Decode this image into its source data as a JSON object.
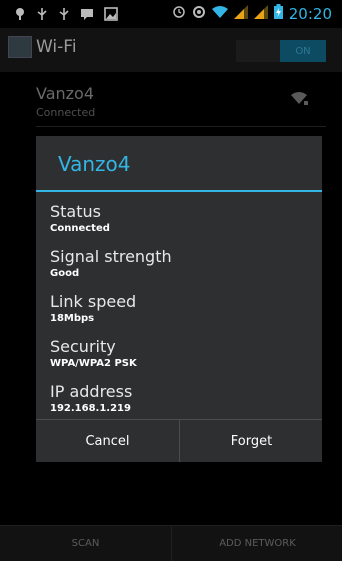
{
  "status_bar": {
    "time": "20:20",
    "left_icons": [
      "usb-icon",
      "usb-icon",
      "usb-icon",
      "message-icon",
      "image-icon"
    ],
    "right_icons": [
      "alarm-icon",
      "sync-icon",
      "wifi-icon",
      "signal-icon",
      "signal-icon",
      "battery-icon"
    ],
    "accent": "#33b5e5"
  },
  "app": {
    "title": "Wi-Fi",
    "toggle_label": "ON"
  },
  "network": {
    "name": "Vanzo4",
    "status": "Connected"
  },
  "dialog": {
    "title": "Vanzo4",
    "fields": [
      {
        "label": "Status",
        "value": "Connected"
      },
      {
        "label": "Signal strength",
        "value": "Good"
      },
      {
        "label": "Link speed",
        "value": "18Mbps"
      },
      {
        "label": "Security",
        "value": "WPA/WPA2 PSK"
      },
      {
        "label": "IP address",
        "value": "192.168.1.219"
      }
    ],
    "cancel_label": "Cancel",
    "forget_label": "Forget"
  },
  "bottom_bar": {
    "scan_label": "SCAN",
    "add_network_label": "ADD NETWORK"
  }
}
